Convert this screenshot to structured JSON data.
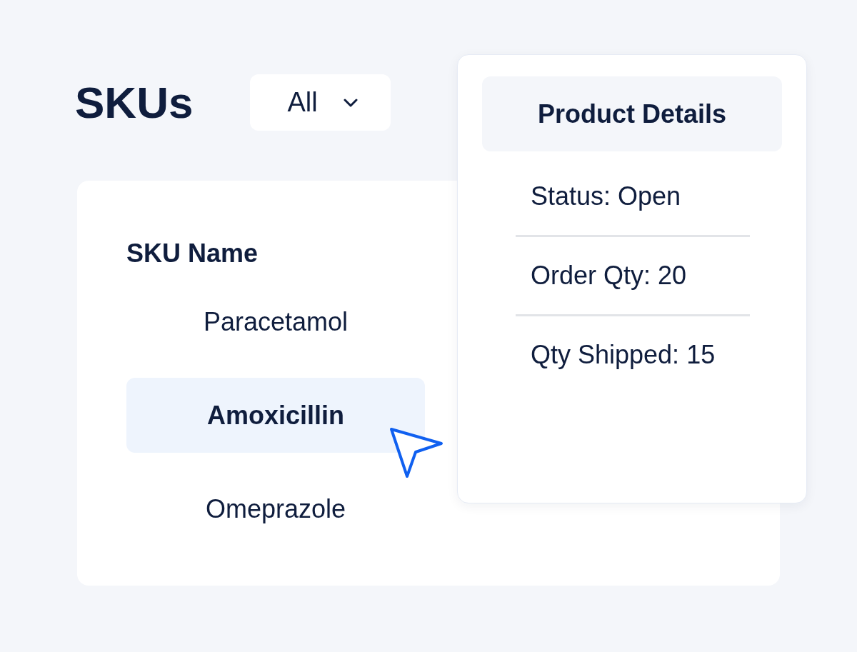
{
  "title": "SKUs",
  "filter": {
    "value": "All"
  },
  "sku_table": {
    "column": "SKU Name",
    "rows": [
      {
        "name": "Paracetamol",
        "selected": false
      },
      {
        "name": "Amoxicillin",
        "selected": true
      },
      {
        "name": "Omeprazole",
        "selected": false
      }
    ]
  },
  "details_panel": {
    "title": "Product Details",
    "fields": [
      "Status: Open",
      "Order Qty: 20",
      "Qty Shipped: 15"
    ]
  }
}
